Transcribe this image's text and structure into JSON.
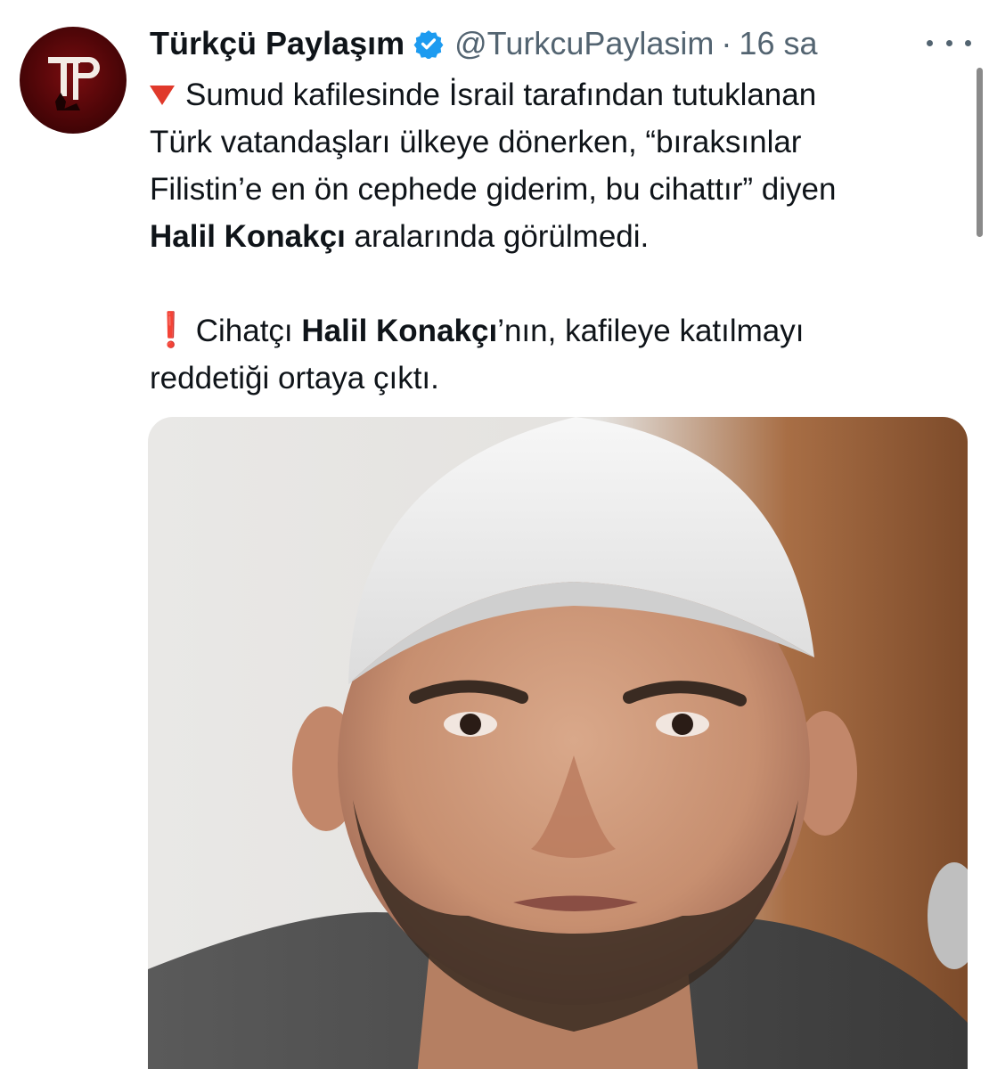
{
  "account": {
    "display_name": "Türkçü Paylaşım",
    "verified_icon": "verified-badge-icon",
    "handle": "@TurkcuPaylasim",
    "separator": "·",
    "time": "16 sa",
    "avatar_icon": "tp-logo-avatar",
    "avatar_logo_text": "TP"
  },
  "tweet": {
    "line1_emoji": "red-down-triangle-icon",
    "line1": "Sumud kafilesinde İsrail tarafından tutuklanan",
    "line2": "Türk vatandaşları ülkeye dönerken, “bıraksınlar",
    "line3": "Filistin’e en ön cephede giderim, bu cihattır” diyen",
    "line4_bold": "Halil Konakçı",
    "line4_rest": " aralarında görülmedi.",
    "line5_emoji_glyph": "❗",
    "line5_prefix": " Cihatçı ",
    "line5_bold": "Halil Konakçı",
    "line5_rest": "’nın, kafileye katılmayı",
    "line6": "reddetiği ortaya çıktı."
  },
  "media": {
    "type": "photo",
    "subject": "man-portrait-white-cap"
  },
  "colors": {
    "verified": "#1d9bf0",
    "muted": "#536471",
    "text": "#0f1419",
    "avatar_bg": "#5a0709"
  }
}
